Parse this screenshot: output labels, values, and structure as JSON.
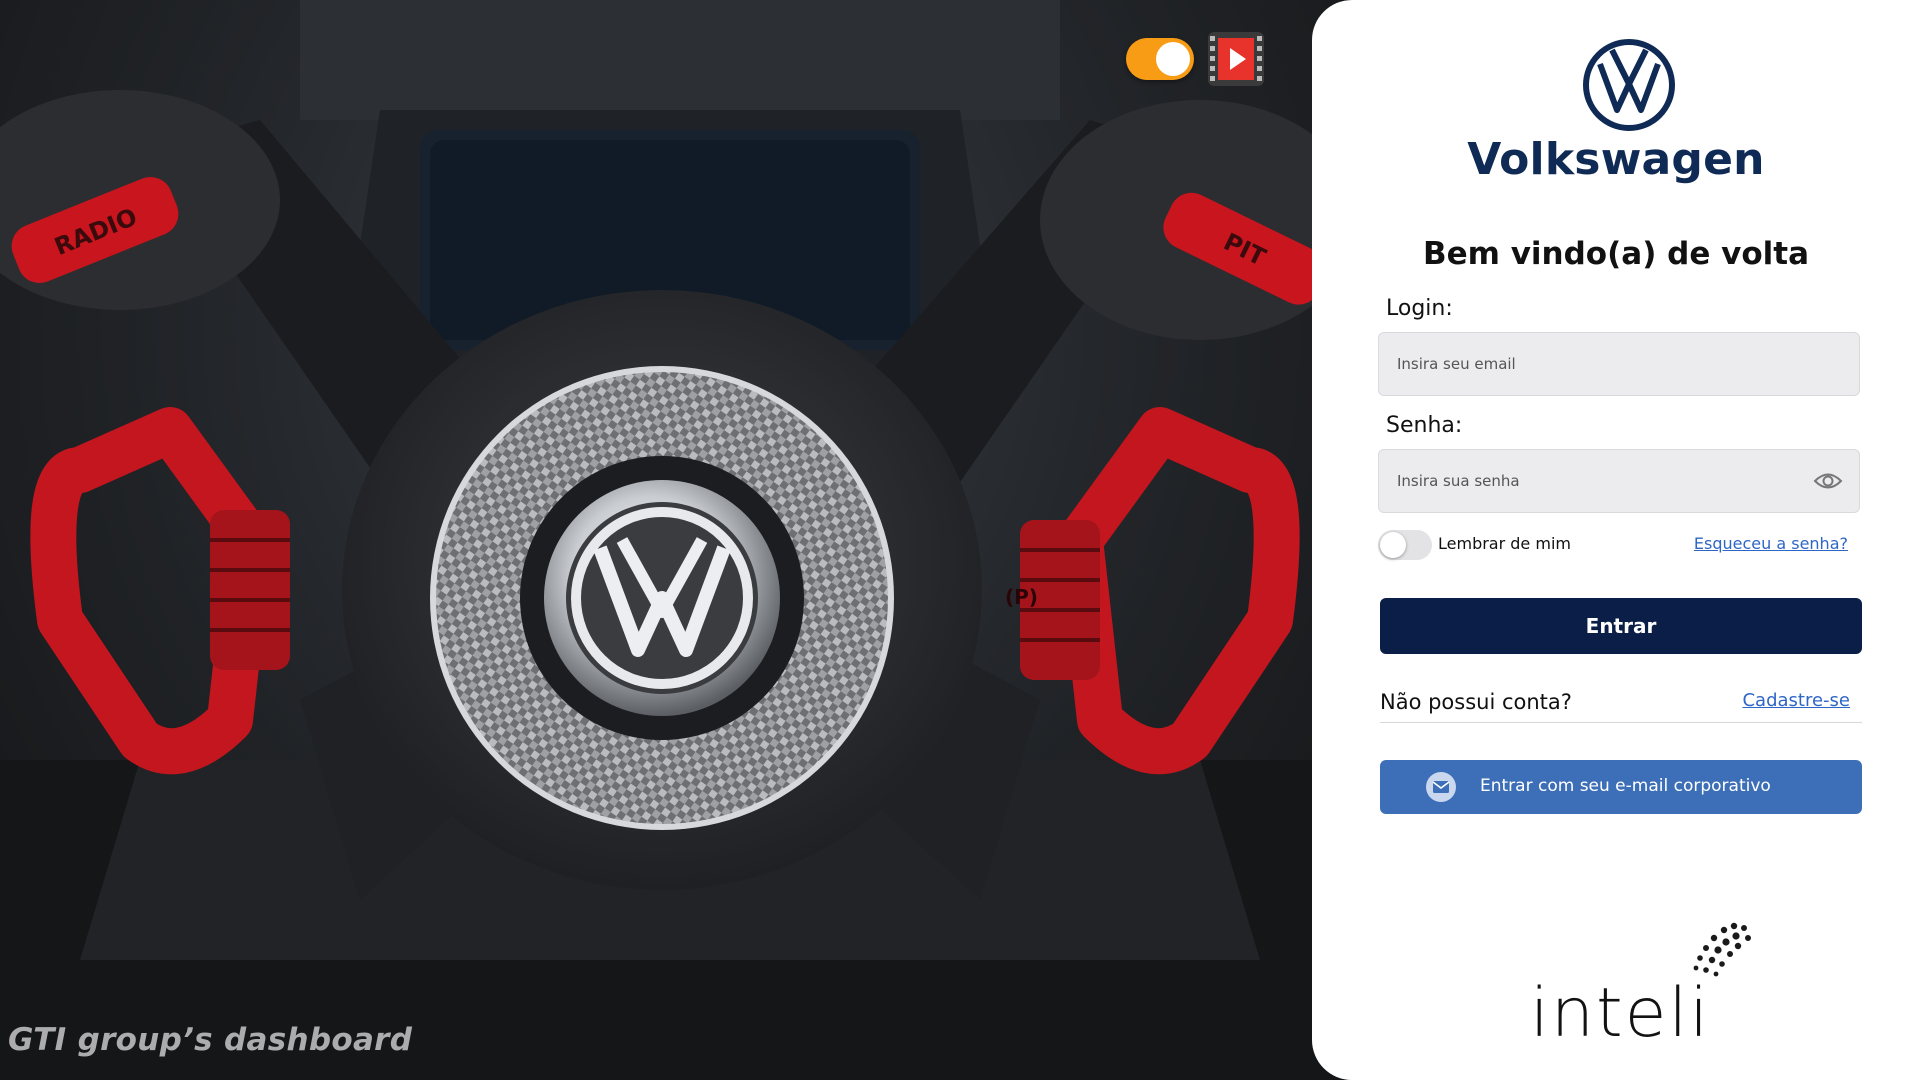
{
  "hero": {
    "caption": "GTI group’s dashboard",
    "wheel_left_badge": "RADIO",
    "wheel_right_badge": "PIT",
    "wheel_gear_mark": "(P)",
    "toggle": {
      "state": "on",
      "color": "#f79c14"
    },
    "video_icon": "play-video-icon"
  },
  "panel": {
    "brand_name": "Volkswagen",
    "brand_color": "#0e2a55",
    "welcome": "Bem vindo(a) de volta",
    "login_label": "Login:",
    "email_placeholder": "Insira seu email",
    "password_label": "Senha:",
    "password_placeholder": "Insira sua senha",
    "remember_label": "Lembrar de mim",
    "remember_state": "off",
    "forgot_link": "Esqueceu a senha?",
    "submit_label": "Entrar",
    "no_account_text": "Não possui conta?",
    "signup_link": "Cadastre-se",
    "corporate_button": "Entrar com seu e-mail corporativo",
    "partner_logo": "inteli",
    "colors": {
      "primary": "#0b1e48",
      "corporate": "#3d6fb8",
      "link": "#2e66c6"
    }
  }
}
